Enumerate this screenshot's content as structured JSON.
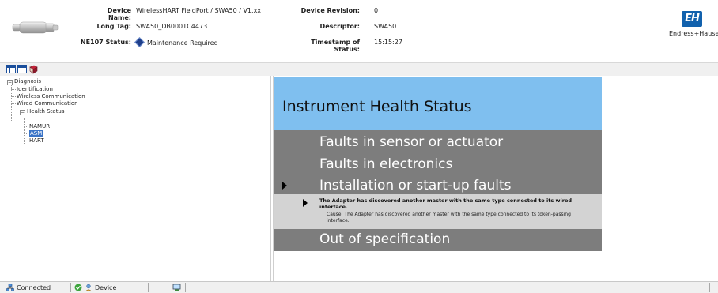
{
  "header": {
    "device_name_label": "Device Name:",
    "device_name_value": "WirelessHART FieldPort / SWA50 / V1.xx",
    "long_tag_label": "Long Tag:",
    "long_tag_value": "SWA50_DB0001C4473",
    "ne107_label": "NE107 Status:",
    "ne107_value": "Maintenance Required",
    "device_revision_label": "Device Revision:",
    "device_revision_value": "0",
    "descriptor_label": "Descriptor:",
    "descriptor_value": "SWA50",
    "timestamp_label": "Timestamp of Status:",
    "timestamp_value": "15:15:27",
    "brand_logo_text": "EH",
    "brand_name": "Endress+Hauser"
  },
  "toolbar": {
    "icons": [
      "window-layout-icon",
      "window-split-icon",
      "book-icon"
    ]
  },
  "tree": {
    "root": {
      "label": "Diagnosis",
      "expander": "⊟"
    },
    "items": [
      {
        "label": "Identification"
      },
      {
        "label": "Wireless Communication"
      },
      {
        "label": "Wired Communication"
      },
      {
        "label": "Health Status",
        "expander": "⊟"
      },
      {
        "label": "NAMUR"
      },
      {
        "label": "ASM",
        "selected": true
      },
      {
        "label": "HART"
      }
    ]
  },
  "content": {
    "title": "Instrument Health Status",
    "categories": [
      {
        "label": "Faults in sensor or actuator"
      },
      {
        "label": "Faults in electronics"
      },
      {
        "label": "Installation or start-up faults"
      },
      {
        "label": "Out of specification"
      }
    ],
    "detail": {
      "message": "The Adapter has discovered another master with the same type connected to its wired interface.",
      "cause": "Cause: The Adapter has discovered another master with the same type connected to its token-passing interface."
    }
  },
  "statusbar": {
    "connection": "Connected",
    "device": "Device"
  },
  "colors": {
    "title_box": "#7fbfef",
    "category_panel": "#7d7d7d",
    "detail_box": "#d3d3d3",
    "selection": "#3b74c6",
    "brand_blue": "#1161ad"
  }
}
